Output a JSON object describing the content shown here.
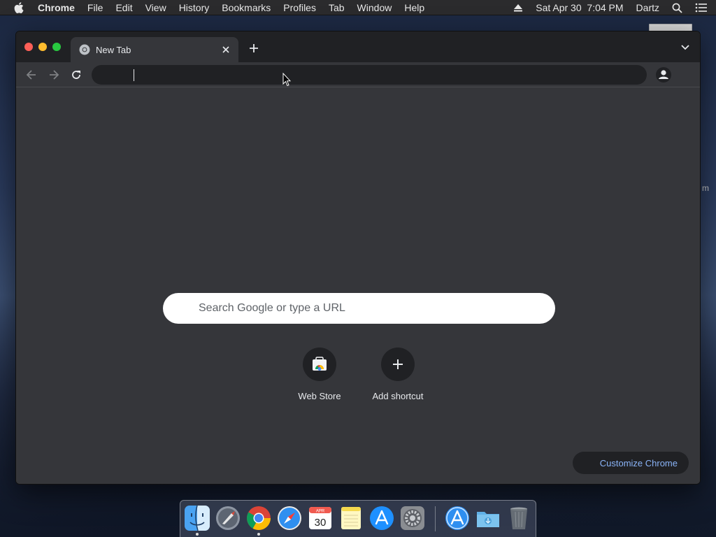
{
  "menubar": {
    "app_name": "Chrome",
    "items": [
      "File",
      "Edit",
      "View",
      "History",
      "Bookmarks",
      "Profiles",
      "Tab",
      "Window",
      "Help"
    ],
    "datetime": "Sat Apr 30  7:04 PM",
    "user": "Dartz"
  },
  "desktop": {
    "partial_label": "m"
  },
  "browser": {
    "tab": {
      "title": "New Tab"
    },
    "omnibox": {
      "value": ""
    },
    "ntp": {
      "search_placeholder": "Search Google or type a URL",
      "shortcuts": [
        {
          "label": "Web Store",
          "icon": "webstore-icon"
        },
        {
          "label": "Add shortcut",
          "icon": "plus-icon"
        }
      ],
      "customize_label": "Customize Chrome"
    }
  },
  "dock": {
    "apps": [
      "finder",
      "launchpad",
      "chrome",
      "safari",
      "calendar",
      "notes",
      "app-store",
      "system-preferences",
      "app-store-downloads",
      "downloads-folder",
      "trash"
    ],
    "calendar_month": "APR",
    "calendar_day": "30"
  },
  "colors": {
    "window_bg": "#35363a",
    "tabstrip_bg": "#202124",
    "accent_link": "#8ab4f8"
  }
}
